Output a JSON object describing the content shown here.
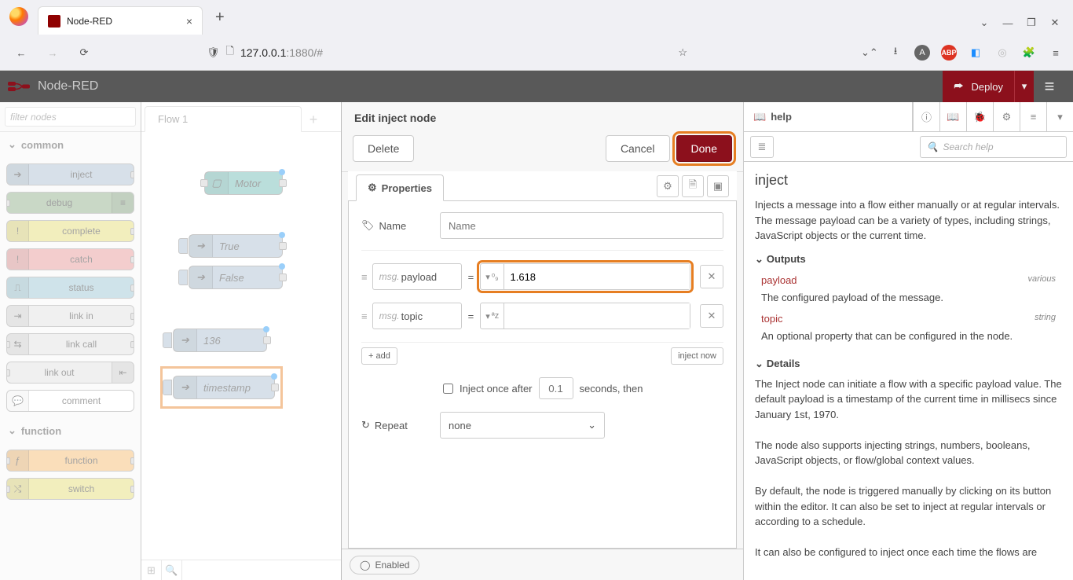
{
  "browser": {
    "tab_title": "Node-RED",
    "url_host": "127.0.0.1",
    "url_path": ":1880/#"
  },
  "header": {
    "title": "Node-RED",
    "deploy_label": "Deploy"
  },
  "palette": {
    "filter_placeholder": "filter nodes",
    "cat_common": "common",
    "cat_function": "function",
    "nodes": {
      "inject": "inject",
      "debug": "debug",
      "complete": "complete",
      "catch": "catch",
      "status": "status",
      "link_in": "link in",
      "link_call": "link call",
      "link_out": "link out",
      "comment": "comment",
      "function": "function",
      "switch": "switch"
    }
  },
  "workspace": {
    "tab": "Flow 1",
    "nodes": {
      "motor": "Motor",
      "true": "True",
      "false": "False",
      "n136": "136",
      "timestamp": "timestamp"
    }
  },
  "tray": {
    "title": "Edit inject node",
    "delete": "Delete",
    "cancel": "Cancel",
    "done": "Done",
    "tab_properties": "Properties",
    "name_label": "Name",
    "name_placeholder": "Name",
    "rows": [
      {
        "prop": "payload",
        "type_icon": "⁰₉",
        "value": "1.618"
      },
      {
        "prop": "topic",
        "type_icon": "ªz",
        "value": ""
      }
    ],
    "msg_prefix": "msg.",
    "equals": "=",
    "add": "add",
    "inject_now": "inject now",
    "inject_once": "Inject once after",
    "inject_once_val": "0.1",
    "inject_once_suffix": "seconds, then",
    "repeat_label": "Repeat",
    "repeat_value": "none",
    "enabled": "Enabled"
  },
  "sidebar": {
    "tab_help": "help",
    "search_placeholder": "Search help",
    "h2": "inject",
    "intro": "Injects a message into a flow either manually or at regular intervals. The message payload can be a variety of types, including strings, JavaScript objects or the current time.",
    "sect_outputs": "Outputs",
    "out_payload": "payload",
    "out_payload_t": "various",
    "out_payload_desc": "The configured payload of the message.",
    "out_topic": "topic",
    "out_topic_t": "string",
    "out_topic_desc": "An optional property that can be configured in the node.",
    "sect_details": "Details",
    "details_p1": "The Inject node can initiate a flow with a specific payload value. The default payload is a timestamp of the current time in millisecs since January 1st, 1970.",
    "details_p2": "The node also supports injecting strings, numbers, booleans, JavaScript objects, or flow/global context values.",
    "details_p3": "By default, the node is triggered manually by clicking on its button within the editor. It can also be set to inject at regular intervals or according to a schedule.",
    "details_p4": "It can also be configured to inject once each time the flows are"
  }
}
